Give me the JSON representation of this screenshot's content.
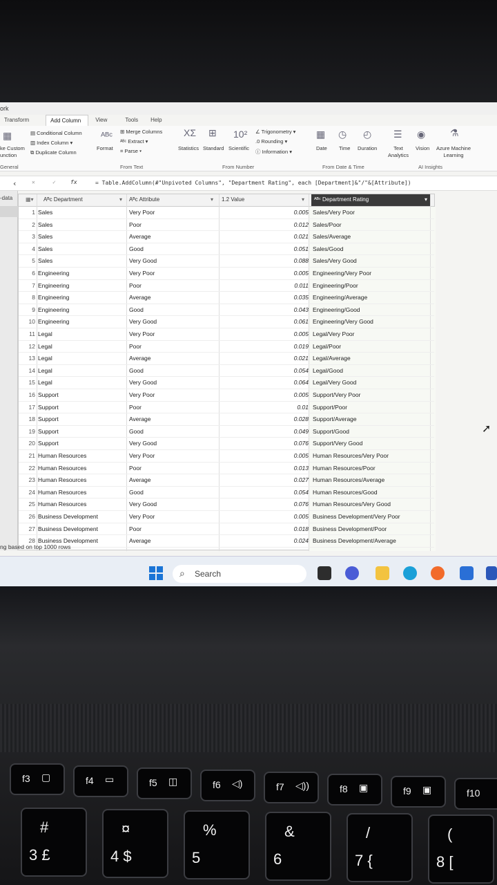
{
  "window": {
    "title_fragment": "ork"
  },
  "ribbon_tabs": [
    "Transform",
    "Add Column",
    "View",
    "Tools",
    "Help"
  ],
  "ribbon": {
    "custom_function": "ke Custom\nunction",
    "conditional_column": "Conditional Column",
    "index_column": "Index Column ▾",
    "duplicate_column": "Duplicate Column",
    "format": "Format",
    "merge_columns": "Merge Columns",
    "extract": "Extract ▾",
    "parse": "Parse ▾",
    "statistics": "Statistics",
    "standard": "Standard",
    "scientific": "Scientific",
    "trigonometry": "Trigonometry ▾",
    "rounding": "Rounding ▾",
    "information": "Information ▾",
    "date": "Date",
    "time": "Time",
    "duration": "Duration",
    "text_analytics": "Text\nAnalytics",
    "vision": "Vision",
    "azure_ml": "Azure Machine\nLearning",
    "groups": [
      "General",
      "From Text",
      "From Number",
      "From Date & Time",
      "AI Insights"
    ]
  },
  "formula": "= Table.AddColumn(#\"Unpivoted Columns\", \"Department Rating\", each [Department]&\"/\"&[Attribute])",
  "nav_label": "-data",
  "columns": {
    "department": "Department",
    "attribute": "Attribute",
    "value": "Value",
    "rating": "Department Rating"
  },
  "rows": [
    [
      "1",
      "Sales",
      "Very Poor",
      "0.005",
      "Sales/Very Poor"
    ],
    [
      "2",
      "Sales",
      "Poor",
      "0.012",
      "Sales/Poor"
    ],
    [
      "3",
      "Sales",
      "Average",
      "0.021",
      "Sales/Average"
    ],
    [
      "4",
      "Sales",
      "Good",
      "0.051",
      "Sales/Good"
    ],
    [
      "5",
      "Sales",
      "Very Good",
      "0.088",
      "Sales/Very Good"
    ],
    [
      "6",
      "Engineering",
      "Very Poor",
      "0.005",
      "Engineering/Very Poor"
    ],
    [
      "7",
      "Engineering",
      "Poor",
      "0.011",
      "Engineering/Poor"
    ],
    [
      "8",
      "Engineering",
      "Average",
      "0.035",
      "Engineering/Average"
    ],
    [
      "9",
      "Engineering",
      "Good",
      "0.043",
      "Engineering/Good"
    ],
    [
      "10",
      "Engineering",
      "Very Good",
      "0.061",
      "Engineering/Very Good"
    ],
    [
      "11",
      "Legal",
      "Very Poor",
      "0.005",
      "Legal/Very Poor"
    ],
    [
      "12",
      "Legal",
      "Poor",
      "0.019",
      "Legal/Poor"
    ],
    [
      "13",
      "Legal",
      "Average",
      "0.021",
      "Legal/Average"
    ],
    [
      "14",
      "Legal",
      "Good",
      "0.054",
      "Legal/Good"
    ],
    [
      "15",
      "Legal",
      "Very Good",
      "0.064",
      "Legal/Very Good"
    ],
    [
      "16",
      "Support",
      "Very Poor",
      "0.005",
      "Support/Very Poor"
    ],
    [
      "17",
      "Support",
      "Poor",
      "0.01",
      "Support/Poor"
    ],
    [
      "18",
      "Support",
      "Average",
      "0.028",
      "Support/Average"
    ],
    [
      "19",
      "Support",
      "Good",
      "0.049",
      "Support/Good"
    ],
    [
      "20",
      "Support",
      "Very Good",
      "0.076",
      "Support/Very Good"
    ],
    [
      "21",
      "Human Resources",
      "Very Poor",
      "0.005",
      "Human Resources/Very Poor"
    ],
    [
      "22",
      "Human Resources",
      "Poor",
      "0.013",
      "Human Resources/Poor"
    ],
    [
      "23",
      "Human Resources",
      "Average",
      "0.027",
      "Human Resources/Average"
    ],
    [
      "24",
      "Human Resources",
      "Good",
      "0.054",
      "Human Resources/Good"
    ],
    [
      "25",
      "Human Resources",
      "Very Good",
      "0.076",
      "Human Resources/Very Good"
    ],
    [
      "26",
      "Business Development",
      "Very Poor",
      "0.005",
      "Business Development/Very Poor"
    ],
    [
      "27",
      "Business Development",
      "Poor",
      "0.018",
      "Business Development/Poor"
    ],
    [
      "28",
      "Business Development",
      "Average",
      "0.024",
      "Business Development/Average"
    ]
  ],
  "status": "ng based on top 1000 rows",
  "taskbar": {
    "search": "Search"
  },
  "keys": [
    {
      "top": "f3",
      "icon": "▢"
    },
    {
      "top": "f4",
      "icon": "▭"
    },
    {
      "top": "f5",
      "icon": "◫"
    },
    {
      "top": "f6",
      "icon": "◁)"
    },
    {
      "top": "f7",
      "icon": "◁))"
    },
    {
      "top": "f8",
      "icon": "▣"
    },
    {
      "top": "f9",
      "icon": "▣"
    },
    {
      "top": "f10",
      "icon": ""
    }
  ],
  "numkeys": [
    {
      "top": "#",
      "bottom": "3 £"
    },
    {
      "top": "¤",
      "bottom": "4 $"
    },
    {
      "top": "%",
      "bottom": "5"
    },
    {
      "top": "&",
      "bottom": "6"
    },
    {
      "top": "/",
      "bottom": "7 {"
    },
    {
      "top": "(",
      "bottom": "8 ["
    }
  ]
}
